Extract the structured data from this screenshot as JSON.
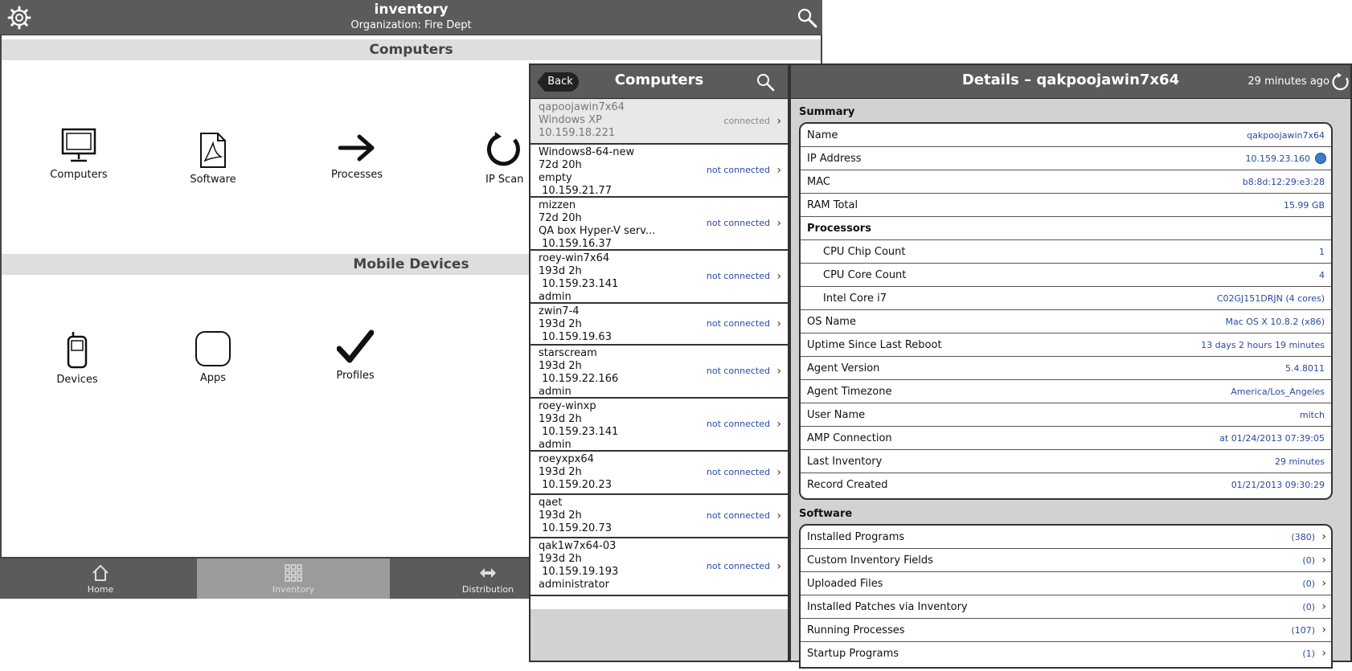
{
  "app": {
    "title": "inventory",
    "subtitle": "Organization: Fire Dept"
  },
  "sections": {
    "computers": "Computers",
    "mobile": "Mobile Devices"
  },
  "tiles_computers": [
    {
      "label": "Computers",
      "icon": "monitor-icon"
    },
    {
      "label": "Software",
      "icon": "document-icon"
    },
    {
      "label": "Processes",
      "icon": "arrow-right-icon"
    },
    {
      "label": "IP Scan",
      "icon": "refresh-icon"
    }
  ],
  "tiles_mobile": [
    {
      "label": "Devices",
      "icon": "phone-icon"
    },
    {
      "label": "Apps",
      "icon": "app-square-icon"
    },
    {
      "label": "Profiles",
      "icon": "checkmark-icon"
    }
  ],
  "tabs": [
    {
      "label": "Home",
      "icon": "home-icon"
    },
    {
      "label": "Inventory",
      "icon": "grid-icon"
    },
    {
      "label": "Distribution",
      "icon": "double-arrow-icon"
    }
  ],
  "list": {
    "back_label": "Back",
    "title": "Computers"
  },
  "computers": [
    {
      "lines": [
        "qapoojawin7x64",
        "Windows XP",
        "10.159.18.221"
      ],
      "status": "connected"
    },
    {
      "lines": [
        "Windows8-64-new",
        "72d 20h",
        "empty",
        " 10.159.21.77"
      ],
      "status": "not connected"
    },
    {
      "lines": [
        "mizzen",
        "72d 20h",
        "QA box Hyper-V serv...",
        " 10.159.16.37"
      ],
      "status": "not connected"
    },
    {
      "lines": [
        "roey-win7x64",
        "193d 2h",
        " 10.159.23.141",
        "admin"
      ],
      "status": "not connected"
    },
    {
      "lines": [
        "zwin7-4",
        "193d 2h",
        " 10.159.19.63"
      ],
      "status": "not connected"
    },
    {
      "lines": [
        "starscream",
        "193d 2h",
        " 10.159.22.166",
        "admin"
      ],
      "status": "not connected"
    },
    {
      "lines": [
        "roey-winxp",
        "193d 2h",
        " 10.159.23.141",
        "admin"
      ],
      "status": "not connected"
    },
    {
      "lines": [
        "roeyxpx64",
        "193d 2h",
        " 10.159.20.23"
      ],
      "status": "not connected"
    },
    {
      "lines": [
        "qaet",
        "193d 2h",
        " 10.159.20.73"
      ],
      "status": "not connected"
    },
    {
      "lines": [
        "qak1w7x64-03",
        "193d 2h",
        " 10.159.19.193",
        "administrator"
      ],
      "status": "not connected"
    }
  ],
  "details": {
    "title": "Details – qakpoojawin7x64",
    "updated": "29 minutes ago",
    "summary_label": "Summary",
    "summary": [
      {
        "label": "Name",
        "value": "qakpoojawin7x64"
      },
      {
        "label": "IP Address",
        "value": "10.159.23.160",
        "icon": "info-icon"
      },
      {
        "label": "MAC",
        "value": "b8:8d:12:29:e3:28"
      },
      {
        "label": "RAM Total",
        "value": "15.99 GB"
      },
      {
        "label": "Processors",
        "value": "",
        "bold": true
      },
      {
        "label": "CPU Chip Count",
        "value": "1",
        "indent": true
      },
      {
        "label": "CPU Core Count",
        "value": "4",
        "indent": true
      },
      {
        "label": "Intel Core i7",
        "value": "C02GJ151DRJN (4 cores)",
        "indent": true
      },
      {
        "label": "OS Name",
        "value": "Mac OS X 10.8.2 (x86)"
      },
      {
        "label": "Uptime Since Last Reboot",
        "value": "13 days 2 hours 19 minutes"
      },
      {
        "label": "Agent Version",
        "value": "5.4.8011"
      },
      {
        "label": "Agent Timezone",
        "value": "America/Los_Angeles"
      },
      {
        "label": "User Name",
        "value": "mitch"
      },
      {
        "label": "AMP Connection",
        "value": "at 01/24/2013 07:39:05"
      },
      {
        "label": "Last Inventory",
        "value": "29 minutes"
      },
      {
        "label": "Record Created",
        "value": "01/21/2013 09:30:29"
      }
    ],
    "software_label": "Software",
    "software": [
      {
        "label": "Installed Programs",
        "value": "(380)"
      },
      {
        "label": "Custom Inventory Fields",
        "value": "(0)"
      },
      {
        "label": "Uploaded Files",
        "value": "(0)"
      },
      {
        "label": "Installed Patches via Inventory",
        "value": "(0)"
      },
      {
        "label": "Running Processes",
        "value": "(107)"
      },
      {
        "label": "Startup Programs",
        "value": "(1)"
      }
    ]
  },
  "colors": {
    "header": "#5b5b5b",
    "link": "#2a4aa0",
    "section": "#dedede"
  }
}
